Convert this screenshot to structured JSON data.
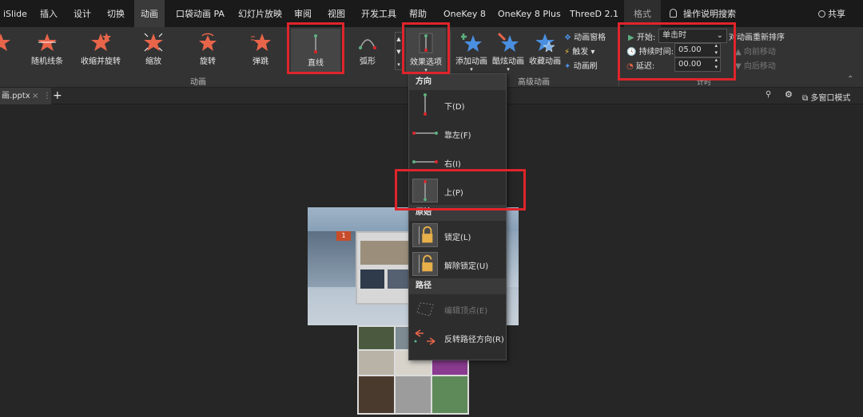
{
  "tabs": [
    "iSlide",
    "插入",
    "设计",
    "切换",
    "动画",
    "口袋动画 PA",
    "幻灯片放映",
    "审阅",
    "视图",
    "开发工具",
    "帮助",
    "OneKey 8",
    "OneKey 8 Plus",
    "ThreeD 2.1",
    "格式",
    "操作说明搜索"
  ],
  "share": "共享",
  "ribbon": {
    "effects": [
      "随机线条",
      "收缩并旋转",
      "缩放",
      "旋转",
      "弹跳",
      "直线",
      "弧形"
    ],
    "group_animation": "动画",
    "effect_options": "效果选项",
    "add_animation": "添加动画",
    "cool_animation": "酷炫动画",
    "fav_animation": "收藏动画",
    "anim_pane": "动画窗格",
    "trigger": "触发",
    "anim_painter": "动画刷",
    "group_advanced": "高级动画",
    "start_label": "开始:",
    "start_value": "单击时",
    "duration_label": "持续时间:",
    "duration_value": "05.00",
    "delay_label": "延迟:",
    "delay_value": "00.00",
    "group_timing": "计时",
    "reorder_title": "对动画重新排序",
    "move_earlier": "向前移动",
    "move_later": "向后移动"
  },
  "doc": {
    "tab": "画.pptx",
    "add": "+",
    "multiwin": "多窗口模式"
  },
  "menu": {
    "sec_direction": "方向",
    "down": "下(D)",
    "left": "靠左(F)",
    "right": "右(I)",
    "up": "上(P)",
    "sec_origin": "原始",
    "lock": "锁定(L)",
    "unlock": "解除锁定(U)",
    "sec_path": "路径",
    "edit_points": "编辑顶点(E)",
    "reverse": "反转路径方向(R)"
  },
  "slide": {
    "number": "1"
  },
  "colors": {
    "accent_red": "#e0242b",
    "star_orange": "#e8654a",
    "star_blue": "#4a8fe0",
    "line_green": "#5db07f"
  }
}
